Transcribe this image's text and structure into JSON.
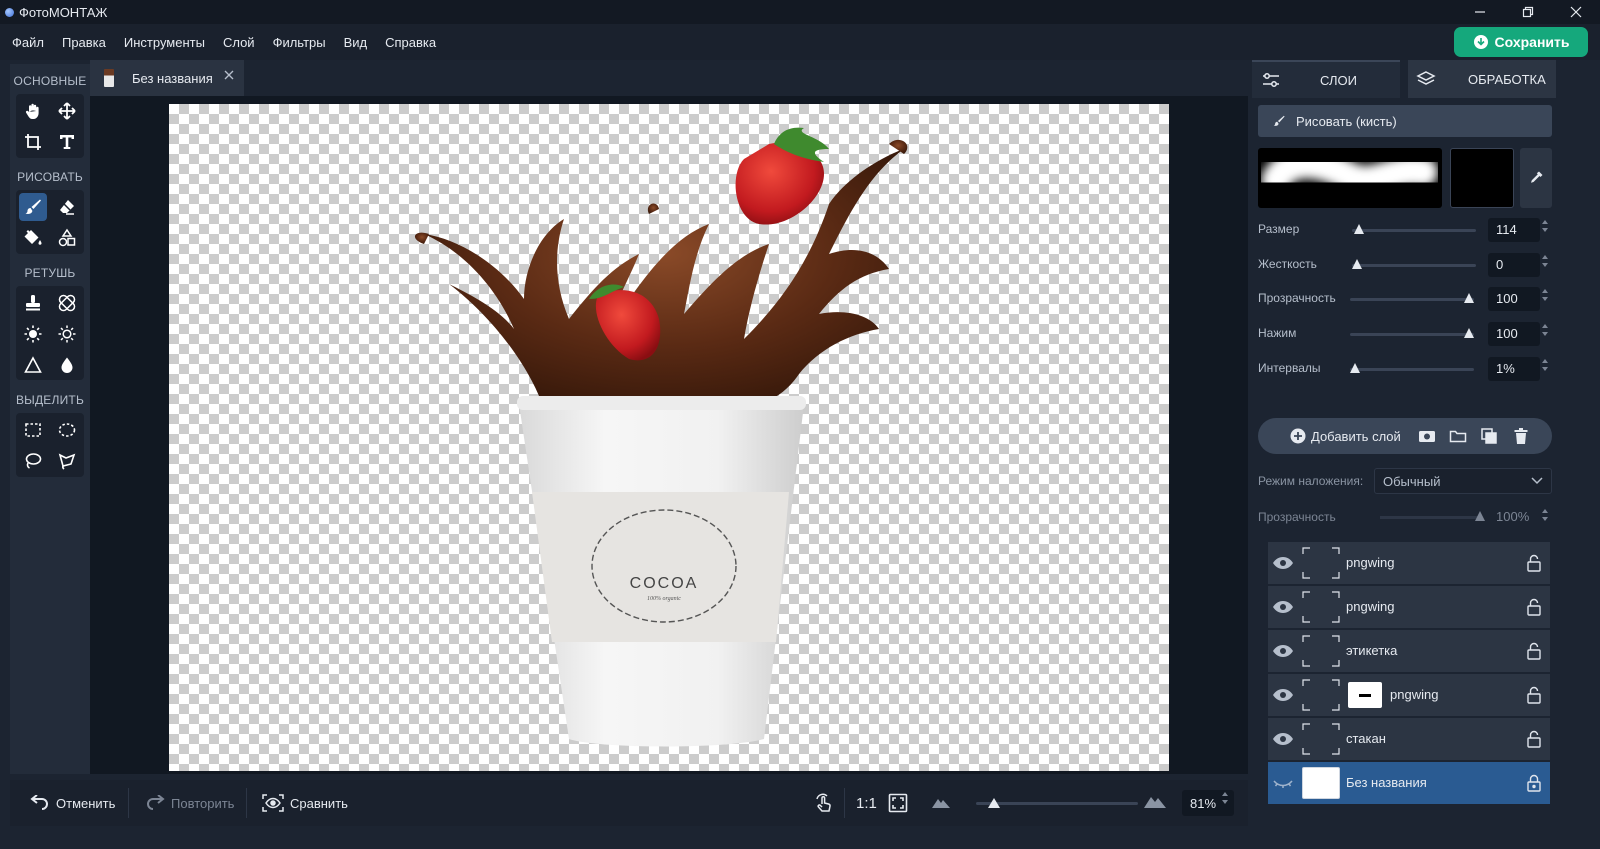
{
  "window": {
    "title": "ФотоМОНТАЖ"
  },
  "menu": {
    "items": [
      "Файл",
      "Правка",
      "Инструменты",
      "Слой",
      "Фильтры",
      "Вид",
      "Справка"
    ],
    "save_label": "Сохранить"
  },
  "toolbar": {
    "sections": {
      "basic": "ОСНОВНЫЕ",
      "draw": "РИСОВАТЬ",
      "retouch": "РЕТУШЬ",
      "select": "ВЫДЕЛИТЬ"
    },
    "active_tool": "brush"
  },
  "document": {
    "tab_name": "Без названия",
    "canvas_label_text": "COCOA",
    "canvas_label_subtext": "100% organic"
  },
  "bottom": {
    "undo_label": "Отменить",
    "redo_label": "Повторить",
    "compare_label": "Сравнить",
    "actual_size_label": "1:1",
    "zoom_value": "81%",
    "zoom_fraction": 0.08
  },
  "right_panel": {
    "tabs": [
      "СЛОИ",
      "ОБРАБОТКА"
    ],
    "draw_mode_label": "Рисовать (кисть)",
    "brush_color": "#000000",
    "params": [
      {
        "label": "Размер",
        "value": "114",
        "fraction": 0.02
      },
      {
        "label": "Жесткость",
        "value": "0",
        "fraction": 0.0
      },
      {
        "label": "Прозрачность",
        "value": "100",
        "fraction": 1.0
      },
      {
        "label": "Нажим",
        "value": "100",
        "fraction": 1.0
      },
      {
        "label": "Интервалы",
        "value": "1%",
        "fraction": 0.0
      }
    ],
    "add_layer_label": "Добавить слой",
    "blend_mode_label": "Режим наложения:",
    "blend_mode_value": "Обычный",
    "layer_opacity_label": "Прозрачность",
    "layer_opacity_value": "100%",
    "layers": [
      {
        "name": "pngwing",
        "has_mask": false,
        "selected": false
      },
      {
        "name": "pngwing",
        "has_mask": false,
        "selected": false
      },
      {
        "name": "этикетка",
        "has_mask": false,
        "selected": false
      },
      {
        "name": "pngwing",
        "has_mask": true,
        "selected": false
      },
      {
        "name": "стакан",
        "has_mask": false,
        "selected": false
      },
      {
        "name": "Без названия",
        "has_mask": false,
        "selected": true
      }
    ]
  },
  "colors": {
    "accent_green": "#15a87c",
    "selection_blue": "#2a5b92",
    "active_tool": "#2f5b8f"
  }
}
